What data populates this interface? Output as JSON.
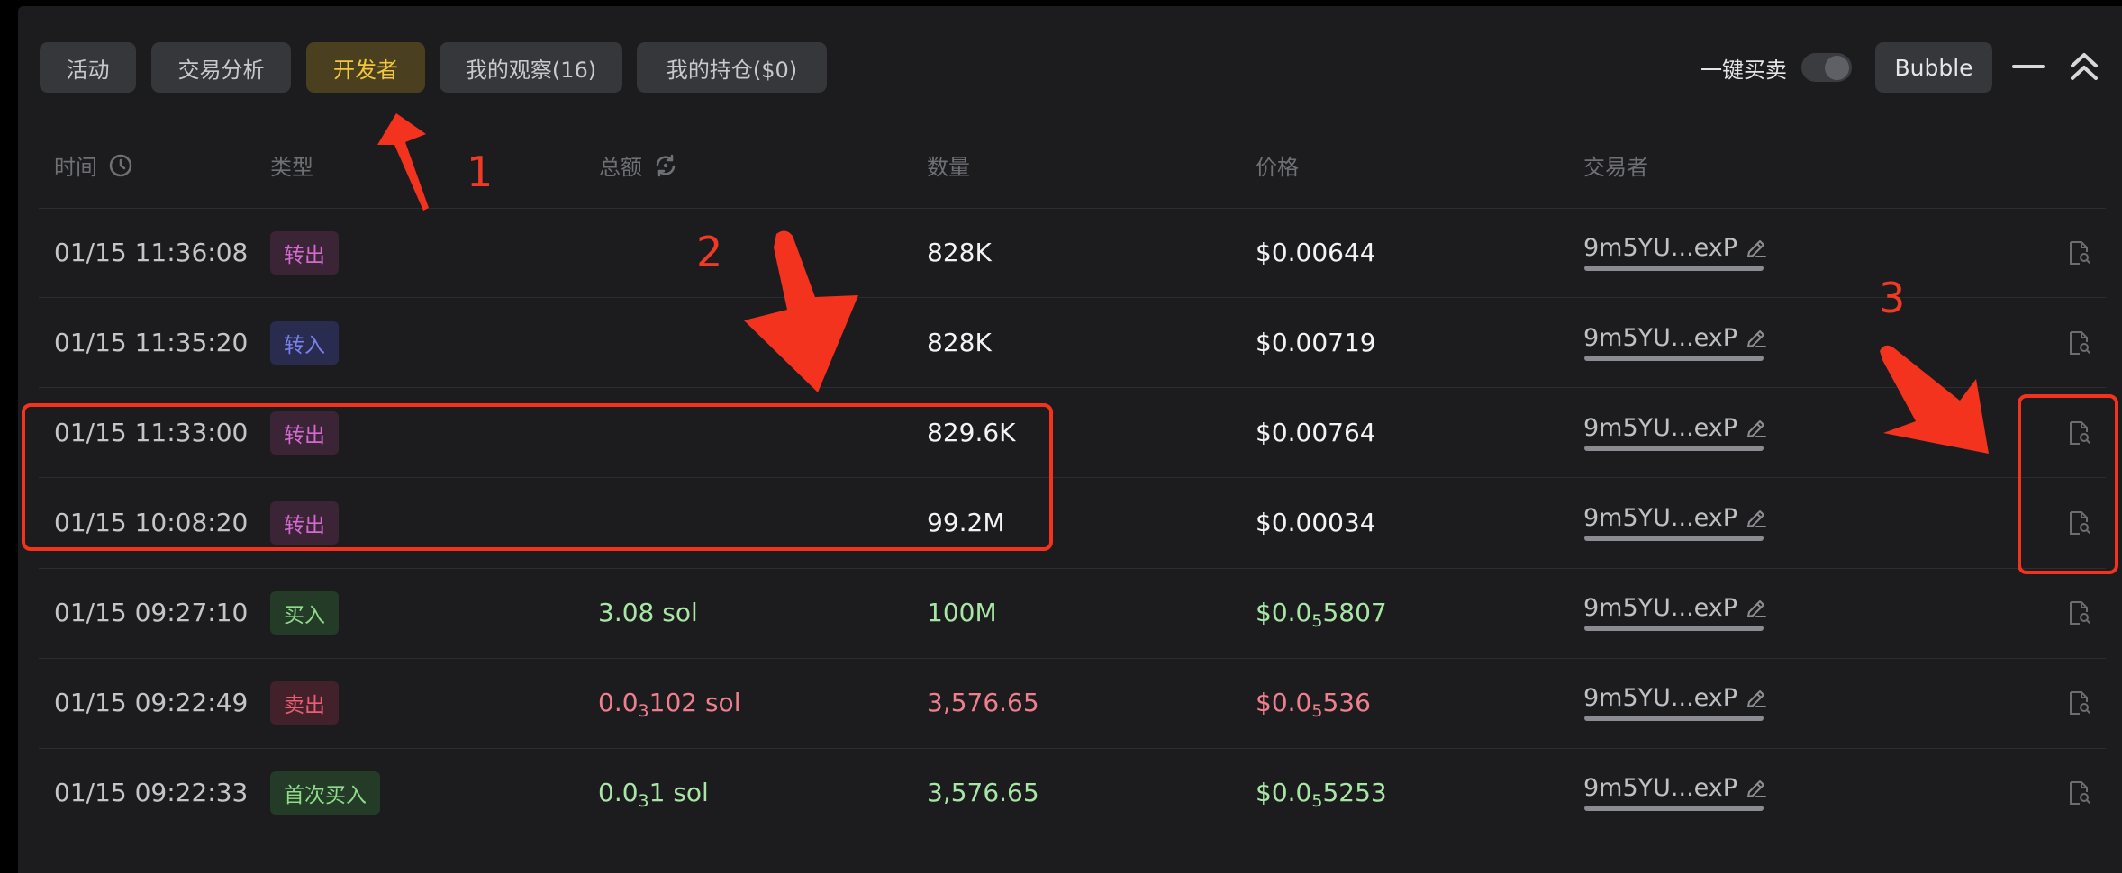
{
  "tabs": [
    {
      "label": "活动",
      "active": false
    },
    {
      "label": "交易分析",
      "active": false
    },
    {
      "label": "开发者",
      "active": true
    },
    {
      "label": "我的观察(16)",
      "active": false
    },
    {
      "label": "我的持仓($0)",
      "active": false
    }
  ],
  "toolbar": {
    "one_click_label": "一键买卖",
    "bubble_label": "Bubble",
    "minimize_icon": "minus-icon",
    "collapse_icon": "chevrons-up-icon"
  },
  "columns": {
    "time": "时间",
    "type": "类型",
    "total": "总额",
    "quantity": "数量",
    "price": "价格",
    "trader": "交易者"
  },
  "rows": [
    {
      "time": "01/15 11:36:08",
      "type": "转出",
      "type_kind": "out",
      "amount": "",
      "amount_sub": "",
      "amount_tail": "",
      "quantity": "828K",
      "price": "$0.00644",
      "price_sub": "",
      "price_tail": "",
      "trader": "9m5YU...exP",
      "color": "white"
    },
    {
      "time": "01/15 11:35:20",
      "type": "转入",
      "type_kind": "in",
      "amount": "",
      "amount_sub": "",
      "amount_tail": "",
      "quantity": "828K",
      "price": "$0.00719",
      "price_sub": "",
      "price_tail": "",
      "trader": "9m5YU...exP",
      "color": "white"
    },
    {
      "time": "01/15 11:33:00",
      "type": "转出",
      "type_kind": "out",
      "amount": "",
      "amount_sub": "",
      "amount_tail": "",
      "quantity": "829.6K",
      "price": "$0.00764",
      "price_sub": "",
      "price_tail": "",
      "trader": "9m5YU...exP",
      "color": "white"
    },
    {
      "time": "01/15 10:08:20",
      "type": "转出",
      "type_kind": "out",
      "amount": "",
      "amount_sub": "",
      "amount_tail": "",
      "quantity": "99.2M",
      "price": "$0.00034",
      "price_sub": "",
      "price_tail": "",
      "trader": "9m5YU...exP",
      "color": "white"
    },
    {
      "time": "01/15 09:27:10",
      "type": "买入",
      "type_kind": "buy",
      "amount": "3.08 sol",
      "amount_sub": "",
      "amount_tail": "",
      "quantity": "100M",
      "price": "$0.0",
      "price_sub": "5",
      "price_tail": "5807",
      "trader": "9m5YU...exP",
      "color": "green"
    },
    {
      "time": "01/15 09:22:49",
      "type": "卖出",
      "type_kind": "sell",
      "amount": "0.0",
      "amount_sub": "3",
      "amount_tail": "102 sol",
      "quantity": "3,576.65",
      "price": "$0.0",
      "price_sub": "5",
      "price_tail": "536",
      "trader": "9m5YU...exP",
      "color": "red"
    },
    {
      "time": "01/15 09:22:33",
      "type": "首次买入",
      "type_kind": "buy",
      "amount": "0.0",
      "amount_sub": "3",
      "amount_tail": "1 sol",
      "quantity": "3,576.65",
      "price": "$0.0",
      "price_sub": "5",
      "price_tail": "5253",
      "trader": "9m5YU...exP",
      "color": "green"
    }
  ],
  "annotations": {
    "n1": "1",
    "n2": "2",
    "n3": "3",
    "color": "#f3331d"
  }
}
